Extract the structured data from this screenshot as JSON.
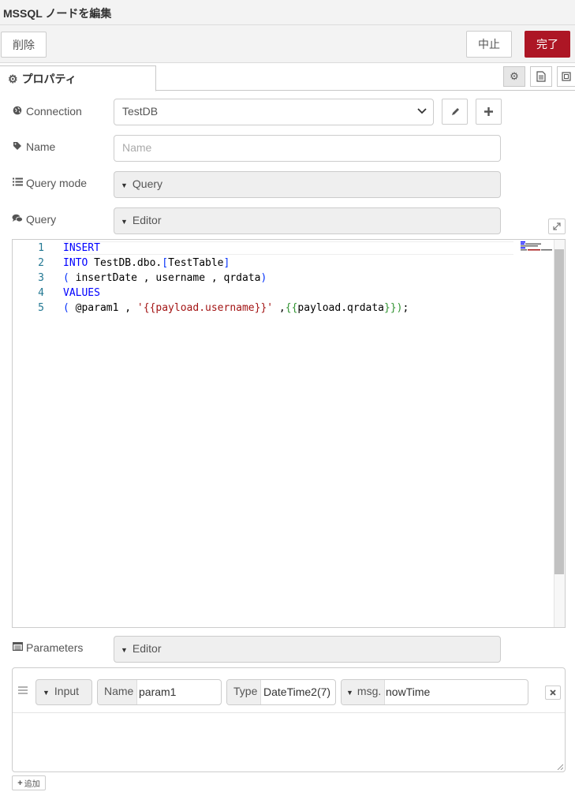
{
  "dialog": {
    "title": "MSSQL ノードを編集"
  },
  "toolbar": {
    "delete_label": "削除",
    "cancel_label": "中止",
    "done_label": "完了"
  },
  "tabs": {
    "properties_label": "プロパティ"
  },
  "form": {
    "connection": {
      "label": "Connection",
      "value": "TestDB"
    },
    "name": {
      "label": "Name",
      "placeholder": "Name"
    },
    "query_mode": {
      "label": "Query mode",
      "value": "Query"
    },
    "query": {
      "label": "Query",
      "value": "Editor"
    },
    "parameters": {
      "label": "Parameters",
      "value": "Editor"
    }
  },
  "editor": {
    "line_numbers": [
      "1",
      "2",
      "3",
      "4",
      "5"
    ],
    "lines": [
      [
        {
          "t": "INSERT",
          "c": "kw"
        }
      ],
      [
        {
          "t": "INTO",
          "c": "kw"
        },
        {
          "t": " TestDB.dbo.",
          "c": ""
        },
        {
          "t": "[",
          "c": "br"
        },
        {
          "t": "TestTable",
          "c": ""
        },
        {
          "t": "]",
          "c": "br"
        }
      ],
      [
        {
          "t": "(",
          "c": "br"
        },
        {
          "t": " insertDate , username , qrdata",
          "c": ""
        },
        {
          "t": ")",
          "c": "br"
        }
      ],
      [
        {
          "t": "VALUES",
          "c": "kw"
        }
      ],
      [
        {
          "t": "(",
          "c": "br"
        },
        {
          "t": " @param1 , ",
          "c": ""
        },
        {
          "t": "'{{payload.username}}'",
          "c": "str"
        },
        {
          "t": " ,",
          "c": ""
        },
        {
          "t": "{{",
          "c": "br2"
        },
        {
          "t": "payload.qrdata",
          "c": ""
        },
        {
          "t": "}})",
          "c": "br2"
        },
        {
          "t": ";",
          "c": ""
        }
      ]
    ]
  },
  "param_row": {
    "direction": "Input",
    "name_prefix": "Name",
    "name_value": "param1",
    "type_prefix": "Type",
    "type_value": "DateTime2(7)",
    "msg_prefix": "msg.",
    "msg_value": "nowTime"
  },
  "add_button": {
    "label": "追加"
  }
}
